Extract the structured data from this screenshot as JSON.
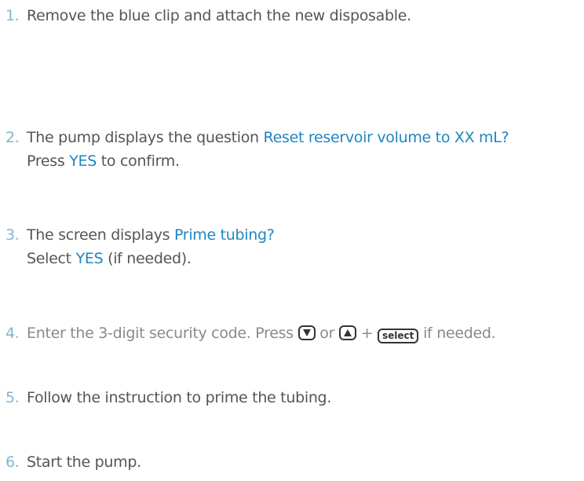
{
  "steps": [
    {
      "number": "1.",
      "text": "Remove the blue clip and attach the new disposable."
    },
    {
      "number": "2.",
      "line1_prefix": "The pump displays the question ",
      "line1_highlight": "Reset reservoir volume to XX mL?",
      "line2_prefix": "Press ",
      "line2_highlight": "YES",
      "line2_suffix": " to confirm."
    },
    {
      "number": "3.",
      "line1_prefix": "The screen displays ",
      "line1_highlight": "Prime tubing?",
      "line2_prefix": "Select ",
      "line2_highlight": "YES",
      "line2_suffix": " (if needed)."
    },
    {
      "number": "4.",
      "text_prefix": "Enter the 3-digit security code. Press ",
      "or_text": " or ",
      "plus_text": " + ",
      "select_key_label": "select",
      "text_suffix": " if needed.",
      "down_key_icon": "down-arrow-key-icon",
      "up_key_icon": "up-arrow-key-icon"
    },
    {
      "number": "5.",
      "text": "Follow the instruction to prime the tubing."
    },
    {
      "number": "6.",
      "text": "Start the pump."
    }
  ],
  "colors": {
    "body_text": "#555555",
    "step_number": "#7fb6d4",
    "highlight": "#1f86bf",
    "muted_text": "#8a8a8a",
    "key_outline": "#333333"
  }
}
